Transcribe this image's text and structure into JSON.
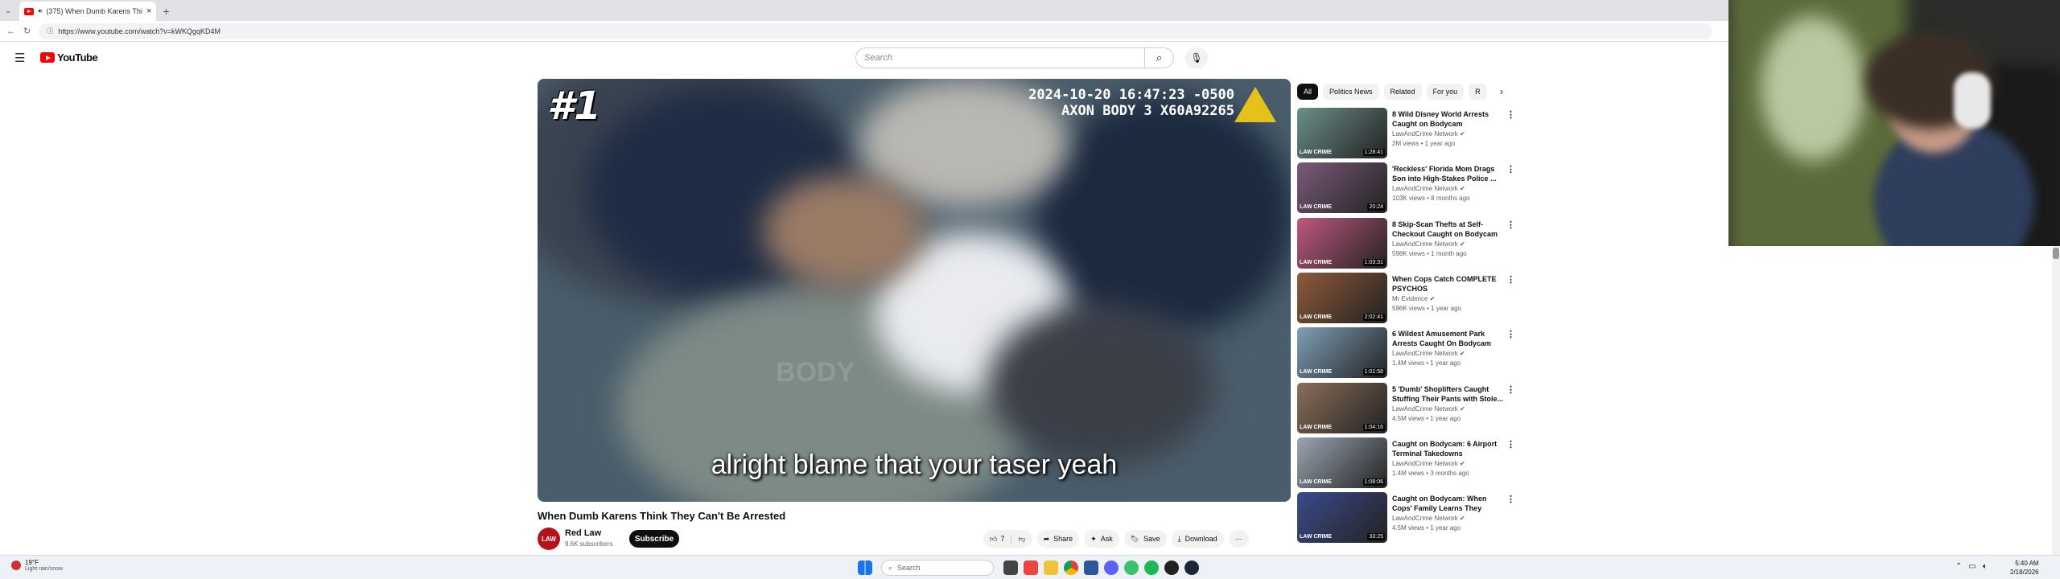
{
  "browser": {
    "tab_title": "(375) When Dumb Karens Thi",
    "tab_close": "×",
    "new_tab": "+",
    "url": "https://www.youtube.com/watch?v=kWKQgqKD4M"
  },
  "header": {
    "logo_text": "YouTube",
    "search_placeholder": "Search"
  },
  "player": {
    "rank_badge": "#1",
    "timestamp_line1": "2024-10-20 16:47:23 -0500",
    "timestamp_line2": "AXON BODY 3 X60A92265",
    "caption": "alright blame that your taser yeah",
    "watermark": "BODY"
  },
  "video": {
    "title": "When Dumb Karens Think They Can't Be Arrested",
    "channel_name": "Red Law",
    "channel_avatar": "LAW",
    "subscribers": "9.6K subscribers",
    "subscribe_label": "Subscribe",
    "like_count": "7",
    "share_label": "Share",
    "ask_label": "Ask",
    "save_label": "Save",
    "download_label": "Download",
    "more": "···"
  },
  "sidebar": {
    "chips": [
      "All",
      "Politics News",
      "Related",
      "For you",
      "R"
    ],
    "recommendations": [
      {
        "title": "8 Wild Disney World Arrests Caught on Bodycam",
        "channel": "LawAndCrime Network",
        "meta": "2M views • 1 year ago",
        "duration": "1:28:41",
        "thumb": "#6b8f8a"
      },
      {
        "title": "'Reckless' Florida Mom Drags Son into High-Stakes Police ...",
        "channel": "LawAndCrime Network",
        "meta": "103K views • 8 months ago",
        "duration": "20:24",
        "thumb": "#7a5a7a"
      },
      {
        "title": "8 Skip-Scan Thefts at Self-Checkout Caught on Bodycam",
        "channel": "LawAndCrime Network",
        "meta": "598K views • 1 month ago",
        "duration": "1:03:31",
        "thumb": "#c0577f"
      },
      {
        "title": "When Cops Catch COMPLETE PSYCHOS",
        "channel": "Mr Evidence",
        "meta": "596K views • 1 year ago",
        "duration": "2:02:41",
        "thumb": "#8e5a3a"
      },
      {
        "title": "6 Wildest Amusement Park Arrests Caught On Bodycam",
        "channel": "LawAndCrime Network",
        "meta": "1.4M views • 1 year ago",
        "duration": "1:01:58",
        "thumb": "#7f9fb8"
      },
      {
        "title": "5 'Dumb' Shoplifters Caught Stuffing Their Pants with Stole...",
        "channel": "LawAndCrime Network",
        "meta": "4.5M views • 1 year ago",
        "duration": "1:04:16",
        "thumb": "#8a6e5a"
      },
      {
        "title": "Caught on Bodycam: 6 Airport Terminal Takedowns",
        "channel": "LawAndCrime Network",
        "meta": "1.4M views • 3 months ago",
        "duration": "1:08:06",
        "thumb": "#9aa6b2"
      },
      {
        "title": "Caught on Bodycam: When Cops' Family Learns They Arre...",
        "channel": "LawAndCrime Network",
        "meta": "4.5M views • 1 year ago",
        "duration": "33:25",
        "thumb": "#3b4a8a"
      }
    ],
    "thumb_badge": "LAW CRIME"
  },
  "taskbar": {
    "weather_temp": "19°F",
    "weather_desc": "Light rain/snow",
    "search_label": "Search",
    "time": "5:40 AM",
    "date": "2/18/2026"
  }
}
